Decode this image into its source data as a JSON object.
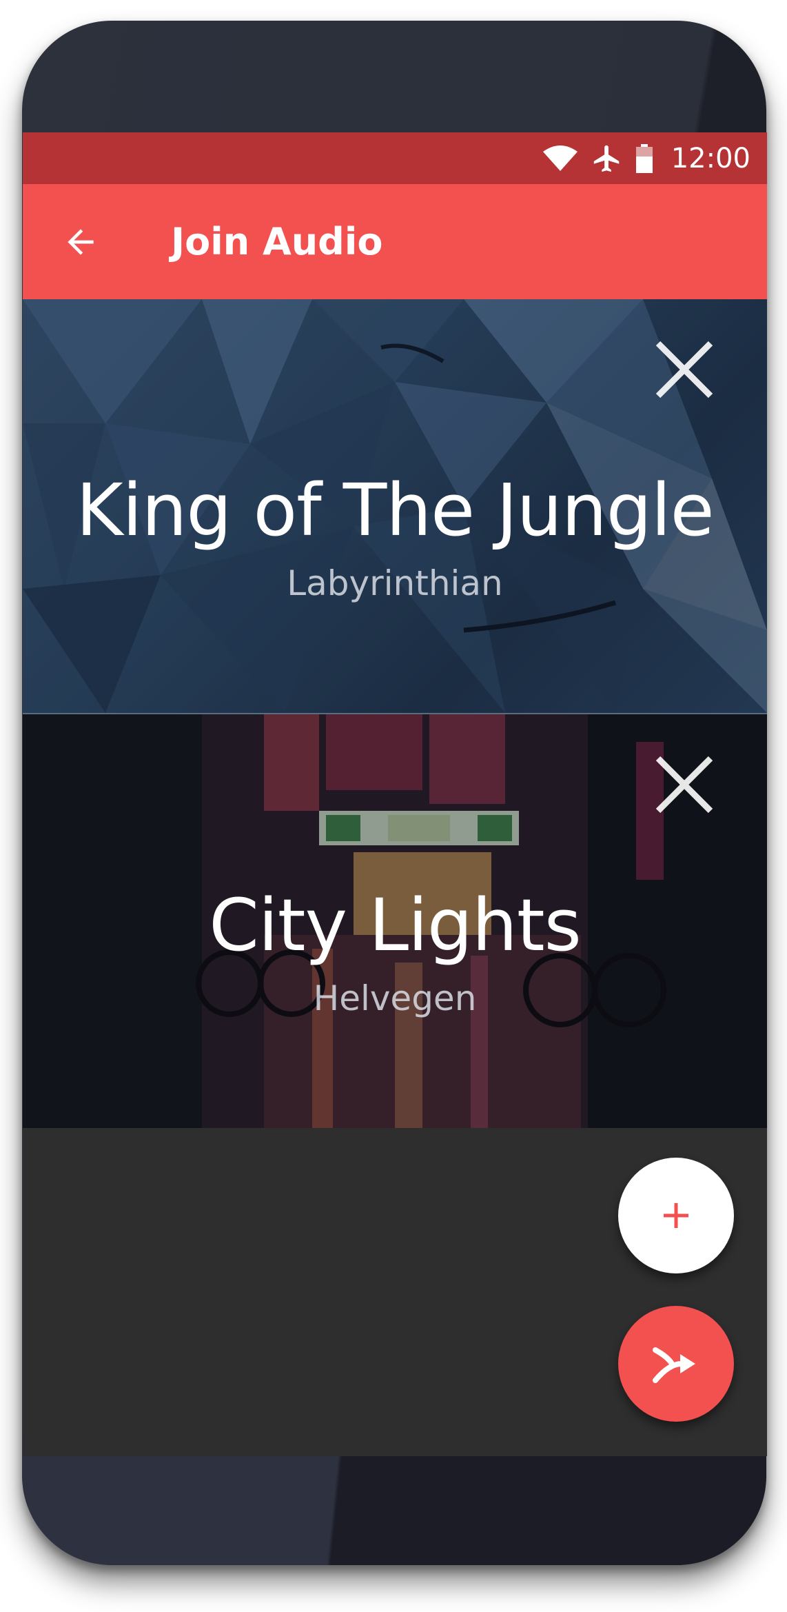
{
  "status_bar": {
    "time": "12:00",
    "icons": [
      "wifi-icon",
      "airplane-mode-icon",
      "battery-icon"
    ]
  },
  "app_bar": {
    "title": "Join Audio",
    "back_icon": "arrow-left-icon"
  },
  "tracks": [
    {
      "title": "King of The Jungle",
      "artist": "Labyrinthian",
      "close_icon": "close-icon"
    },
    {
      "title": "City Lights",
      "artist": "Helvegen",
      "close_icon": "close-icon"
    }
  ],
  "fabs": {
    "add_label": "+",
    "add_icon": "plus-icon",
    "share_icon": "merge-arrow-icon"
  },
  "colors": {
    "status_bar": "#b53334",
    "app_bar": "#f35050",
    "accent": "#f35050",
    "background": "#2e2e2f"
  }
}
